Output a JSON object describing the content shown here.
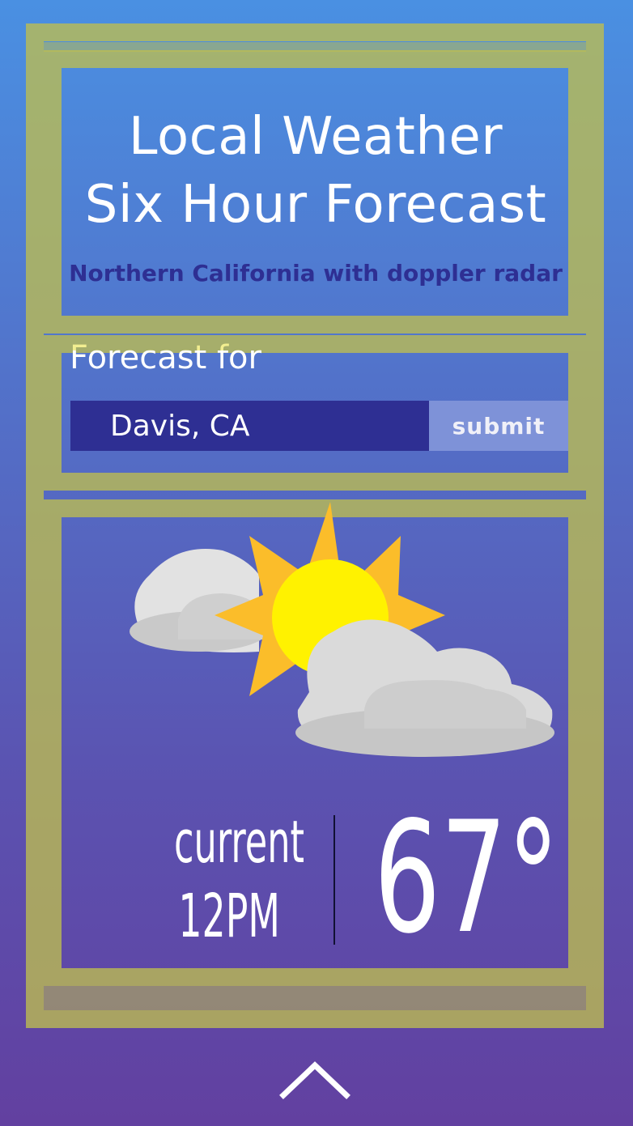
{
  "header": {
    "title_line1": "Local Weather",
    "title_line2": "Six Hour Forecast",
    "subtitle": "Northern California with doppler radar"
  },
  "form": {
    "label": "Forecast for",
    "location_value": "Davis, CA",
    "submit_label": "submit"
  },
  "weather": {
    "icon": "partly-cloudy-icon",
    "current_label": "current",
    "time": "12PM",
    "temperature": "67°"
  },
  "navigation": {
    "scroll_icon": "chevron-up-icon"
  },
  "colors": {
    "background_top": "#4a90e2",
    "background_bottom": "#6240a0",
    "frame": "#bebe50",
    "input_background": "#2e2f93",
    "submit_background": "#7e92d8",
    "subtitle": "#2e2f93",
    "sun_core": "#fff200",
    "sun_rays": "#fbbd2a",
    "cloud": "#d6d6d6"
  }
}
